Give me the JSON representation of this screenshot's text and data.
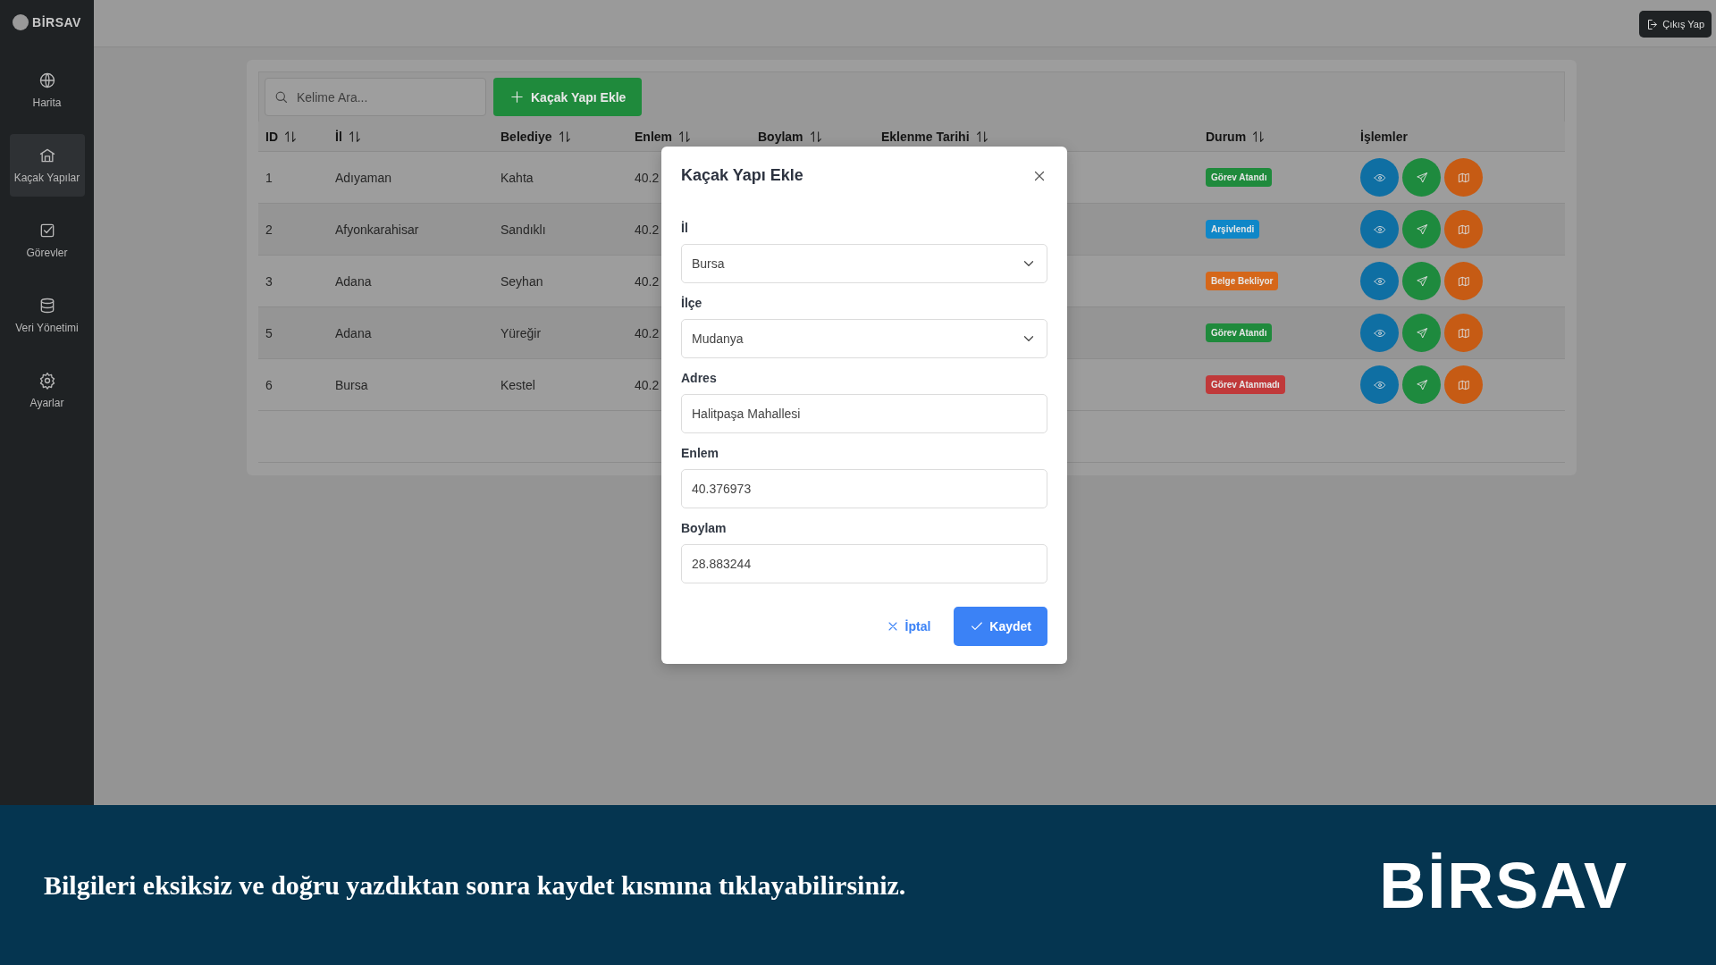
{
  "sidebar": {
    "logo": "BİRSAV",
    "items": [
      {
        "label": "Harita",
        "selected": false
      },
      {
        "label": "Kaçak Yapılar",
        "selected": true
      },
      {
        "label": "Görevler",
        "selected": false
      },
      {
        "label": "Veri Yönetimi",
        "selected": false
      },
      {
        "label": "Ayarlar",
        "selected": false
      }
    ]
  },
  "topbar": {
    "logout": "Çıkış Yap"
  },
  "toolbar": {
    "search": {
      "placeholder": "Kelime Ara..."
    },
    "add_button": "Kaçak Yapı Ekle"
  },
  "table": {
    "columns": [
      {
        "label": "ID",
        "sortable": true
      },
      {
        "label": "İl",
        "sortable": true
      },
      {
        "label": "Belediye",
        "sortable": true
      },
      {
        "label": "Enlem",
        "sortable": true
      },
      {
        "label": "Boylam",
        "sortable": true
      },
      {
        "label": "Eklenme Tarihi",
        "sortable": true
      },
      {
        "label": "Durum",
        "sortable": true
      },
      {
        "label": "İşlemler",
        "sortable": false
      }
    ],
    "rows": [
      {
        "id": "1",
        "il": "Adıyaman",
        "belediye": "Kahta",
        "enlem": "40.2",
        "status": {
          "label": "Görev Atandı",
          "color": "#1f8a3c"
        }
      },
      {
        "id": "2",
        "il": "Afyonkarahisar",
        "belediye": "Sandıklı",
        "enlem": "40.2",
        "status": {
          "label": "Arşivlendi",
          "color": "#0f87c8"
        }
      },
      {
        "id": "3",
        "il": "Adana",
        "belediye": "Seyhan",
        "enlem": "40.2",
        "status": {
          "label": "Belge Bekliyor",
          "color": "#d5671a"
        }
      },
      {
        "id": "5",
        "il": "Adana",
        "belediye": "Yüreğir",
        "enlem": "40.2",
        "status": {
          "label": "Görev Atandı",
          "color": "#1f8a3c"
        }
      },
      {
        "id": "6",
        "il": "Bursa",
        "belediye": "Kestel",
        "enlem": "40.2",
        "status": {
          "label": "Görev Atanmadı",
          "color": "#c0393a"
        }
      }
    ]
  },
  "modal": {
    "title": "Kaçak Yapı Ekle",
    "fields": [
      {
        "kind": "select",
        "label": "İl",
        "value": "Bursa"
      },
      {
        "kind": "select",
        "label": "İlçe",
        "value": "Mudanya"
      },
      {
        "kind": "input",
        "label": "Adres",
        "value": "Halitpaşa Mahallesi"
      },
      {
        "kind": "input",
        "label": "Enlem",
        "value": "40.376973"
      },
      {
        "kind": "input",
        "label": "Boylam",
        "value": "28.883244"
      }
    ],
    "cancel": "İptal",
    "save": "Kaydet"
  },
  "banner": {
    "caption": "Bilgileri eksiksiz ve doğru yazdıktan sonra kaydet kısmına tıklayabilirsiniz.",
    "logo": "BİRSAV"
  }
}
